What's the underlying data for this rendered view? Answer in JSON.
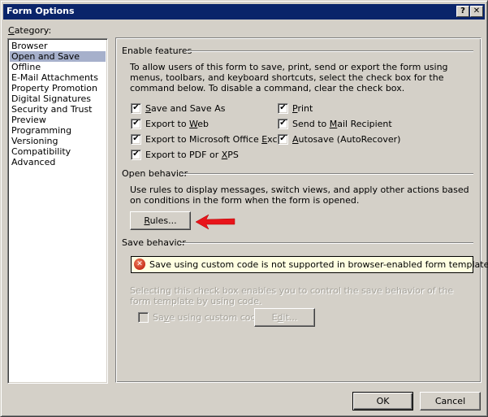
{
  "window": {
    "title": "Form Options",
    "help_glyph": "?",
    "close_glyph": "✕"
  },
  "category": {
    "label_first": "C",
    "label_rest": "ategory:",
    "items": [
      {
        "label": "Browser",
        "selected": false
      },
      {
        "label": "Open and Save",
        "selected": true
      },
      {
        "label": "Offline",
        "selected": false
      },
      {
        "label": "E-Mail Attachments",
        "selected": false
      },
      {
        "label": "Property Promotion",
        "selected": false
      },
      {
        "label": "Digital Signatures",
        "selected": false
      },
      {
        "label": "Security and Trust",
        "selected": false
      },
      {
        "label": "Preview",
        "selected": false
      },
      {
        "label": "Programming",
        "selected": false
      },
      {
        "label": "Versioning",
        "selected": false
      },
      {
        "label": "Compatibility",
        "selected": false
      },
      {
        "label": "Advanced",
        "selected": false
      }
    ]
  },
  "enable_features": {
    "header": "Enable features",
    "description": "To allow users of this form to save, print, send or export the form using menus, toolbars, and keyboard shortcuts, select the check box for the command below.  To disable a command, clear the check box.",
    "checkboxes": [
      {
        "pre": "",
        "key": "S",
        "post": "ave and Save As",
        "checked": true
      },
      {
        "pre": "Export to ",
        "key": "W",
        "post": "eb",
        "checked": true
      },
      {
        "pre": "Export to Microsoft Office ",
        "key": "E",
        "post": "xcel",
        "checked": true
      },
      {
        "pre": "Export to PDF or ",
        "key": "X",
        "post": "PS",
        "checked": true
      },
      {
        "pre": "",
        "key": "P",
        "post": "rint",
        "checked": true
      },
      {
        "pre": "Send to ",
        "key": "M",
        "post": "ail Recipient",
        "checked": true
      },
      {
        "pre": "",
        "key": "A",
        "post": "utosave (AutoRecover)",
        "checked": true
      }
    ]
  },
  "open_behavior": {
    "header": "Open behavior",
    "description": "Use rules to display messages, switch views, and apply other actions based on conditions in the form when the form is opened.",
    "rules_button": {
      "key": "R",
      "rest": "ules..."
    }
  },
  "save_behavior": {
    "header": "Save behavior",
    "warning": "Save using custom code is not supported in browser-enabled form templates.",
    "warning_icon_glyph": "✕",
    "description": "Selecting this check box enables you to control the save behavior of the form template by using code.",
    "custom_code_checkbox": {
      "pre": "Sa",
      "key": "v",
      "post": "e using custom code",
      "checked": false,
      "enabled": false
    },
    "edit_button": {
      "pre": "E",
      "key": "d",
      "post": "it...",
      "enabled": false
    }
  },
  "footer": {
    "ok_label": "OK",
    "cancel_label": "Cancel"
  },
  "check_glyph": "✔",
  "annotation_arrow_color": "#e8141a",
  "titlebar_color": "#0a246a",
  "selection_color": "#a6b0cb"
}
